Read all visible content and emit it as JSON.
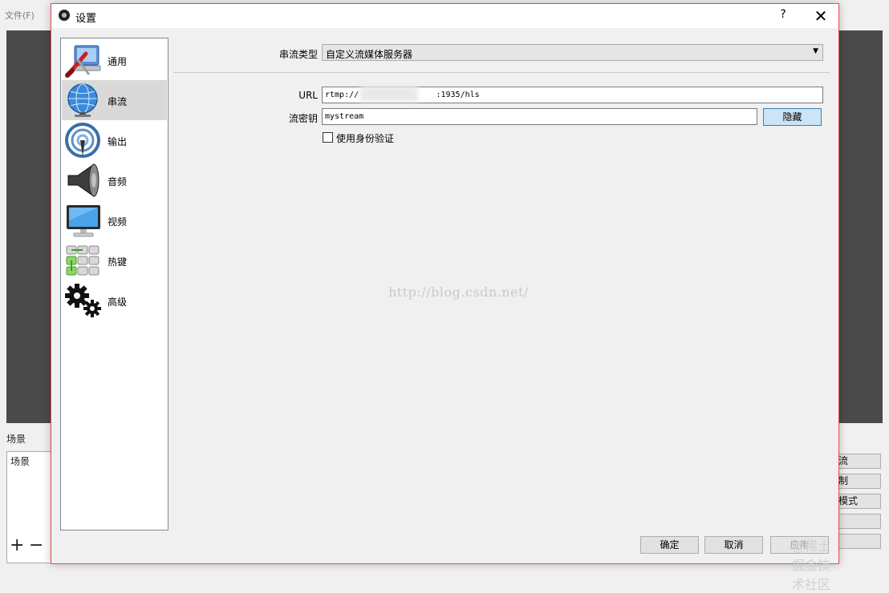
{
  "background_window": {
    "menu": [
      "文件(F)"
    ],
    "scenes_title": "场景",
    "scenes_list_header": "场景",
    "add_glyph": "+",
    "remove_glyph": "−",
    "control_buttons": [
      "流",
      "制",
      "模式",
      ""
    ]
  },
  "dialog": {
    "title": "设置",
    "help_glyph": "?",
    "close_glyph": "✕",
    "sidebar": [
      {
        "label": "通用",
        "icon": "general-settings-icon",
        "selected": false
      },
      {
        "label": "串流",
        "icon": "globe-stream-icon",
        "selected": true
      },
      {
        "label": "输出",
        "icon": "broadcast-output-icon",
        "selected": false
      },
      {
        "label": "音频",
        "icon": "speaker-audio-icon",
        "selected": false
      },
      {
        "label": "视频",
        "icon": "monitor-video-icon",
        "selected": false
      },
      {
        "label": "热键",
        "icon": "keyboard-hotkey-icon",
        "selected": false
      },
      {
        "label": "高级",
        "icon": "gears-advanced-icon",
        "selected": false
      }
    ],
    "stream": {
      "type_label": "串流类型",
      "type_value": "自定义流媒体服务器",
      "dropdown_arrow": "▼",
      "url_label": "URL",
      "url_value": "rtmp://                :1935/hls",
      "key_label": "流密钥",
      "key_value": "mystream",
      "hide_button": "隐藏",
      "auth_checkbox_label": "使用身份验证",
      "auth_checked": false
    },
    "watermark": "http://blog.csdn.net/",
    "footer": {
      "ok": "确定",
      "cancel": "取消",
      "apply": "应用"
    },
    "corner_mark": "@稀土掘金技术社区"
  },
  "colors": {
    "dialog_border": "#e04a5a",
    "selected_item_bg": "#d9d9d9",
    "hide_button_bg": "#cce4f7",
    "preview_bg": "#4a4a4a"
  }
}
